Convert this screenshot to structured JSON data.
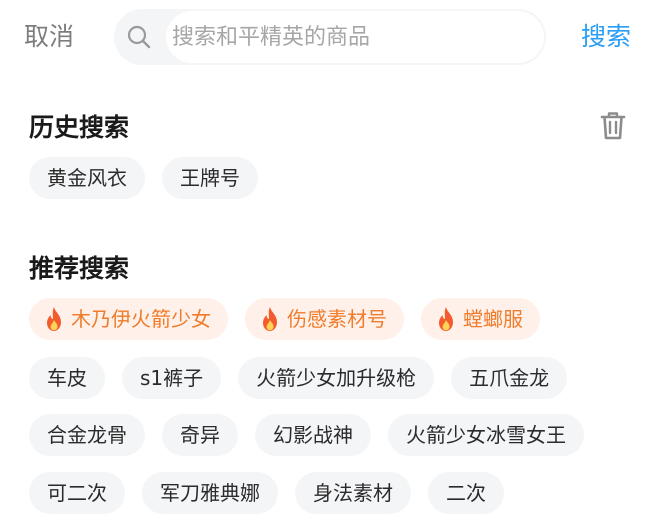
{
  "header": {
    "cancel_label": "取消",
    "search_placeholder": "搜索和平精英的商品",
    "search_value": "",
    "search_button_label": "搜索"
  },
  "history": {
    "title": "历史搜索",
    "items": [
      "黄金风衣",
      "王牌号"
    ]
  },
  "recommend": {
    "title": "推荐搜索",
    "hot_items": [
      "木乃伊火箭少女",
      "伤感素材号",
      "螳螂服"
    ],
    "items_row2": [
      "车皮",
      "s1裤子",
      "火箭少女加升级枪",
      "五爪金龙"
    ],
    "items_row3": [
      "合金龙骨",
      "奇异",
      "幻影战神",
      "火箭少女冰雪女王"
    ],
    "items_row4": [
      "可二次",
      "军刀雅典娜",
      "身法素材",
      "二次"
    ]
  },
  "colors": {
    "accent": "#2a9df4",
    "hot_text": "#f07b2b",
    "hot_bg": "#fff1e9",
    "chip_bg": "#f4f5f7"
  },
  "icons": {
    "search": "search-icon",
    "trash": "trash-icon",
    "hot": "fire-icon"
  }
}
